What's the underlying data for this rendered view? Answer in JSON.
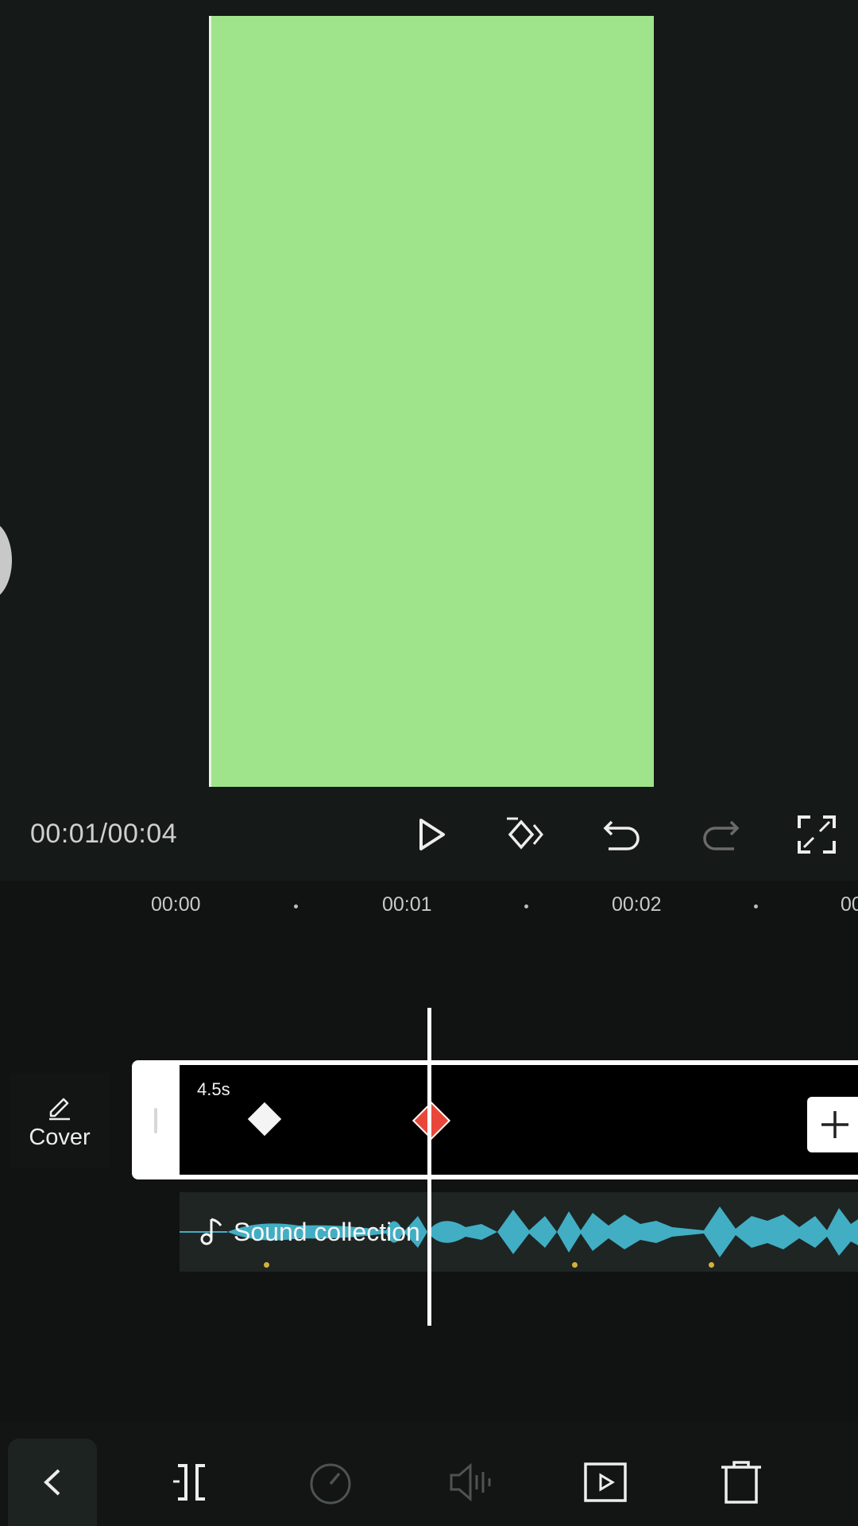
{
  "player": {
    "timecode": "00:01/00:04",
    "video_color": "#9fe38a"
  },
  "ruler": {
    "ticks": [
      "00:00",
      "00:01",
      "00:02",
      "00"
    ]
  },
  "tracks": {
    "cover_label": "Cover",
    "clip_duration": "4.5s",
    "audio_label": "Sound collection",
    "audio_color": "#41aec4",
    "keyframe_active_color": "#e8473a"
  },
  "icons": {
    "play": "play-icon",
    "keyframe": "keyframe-diamond-icon",
    "undo": "undo-icon",
    "redo": "redo-icon",
    "fullscreen": "fullscreen-icon",
    "split": "split-icon",
    "speed": "speed-icon",
    "volume": "volume-icon",
    "animation": "animation-play-icon",
    "delete": "trash-icon",
    "back": "chevron-left-icon"
  }
}
